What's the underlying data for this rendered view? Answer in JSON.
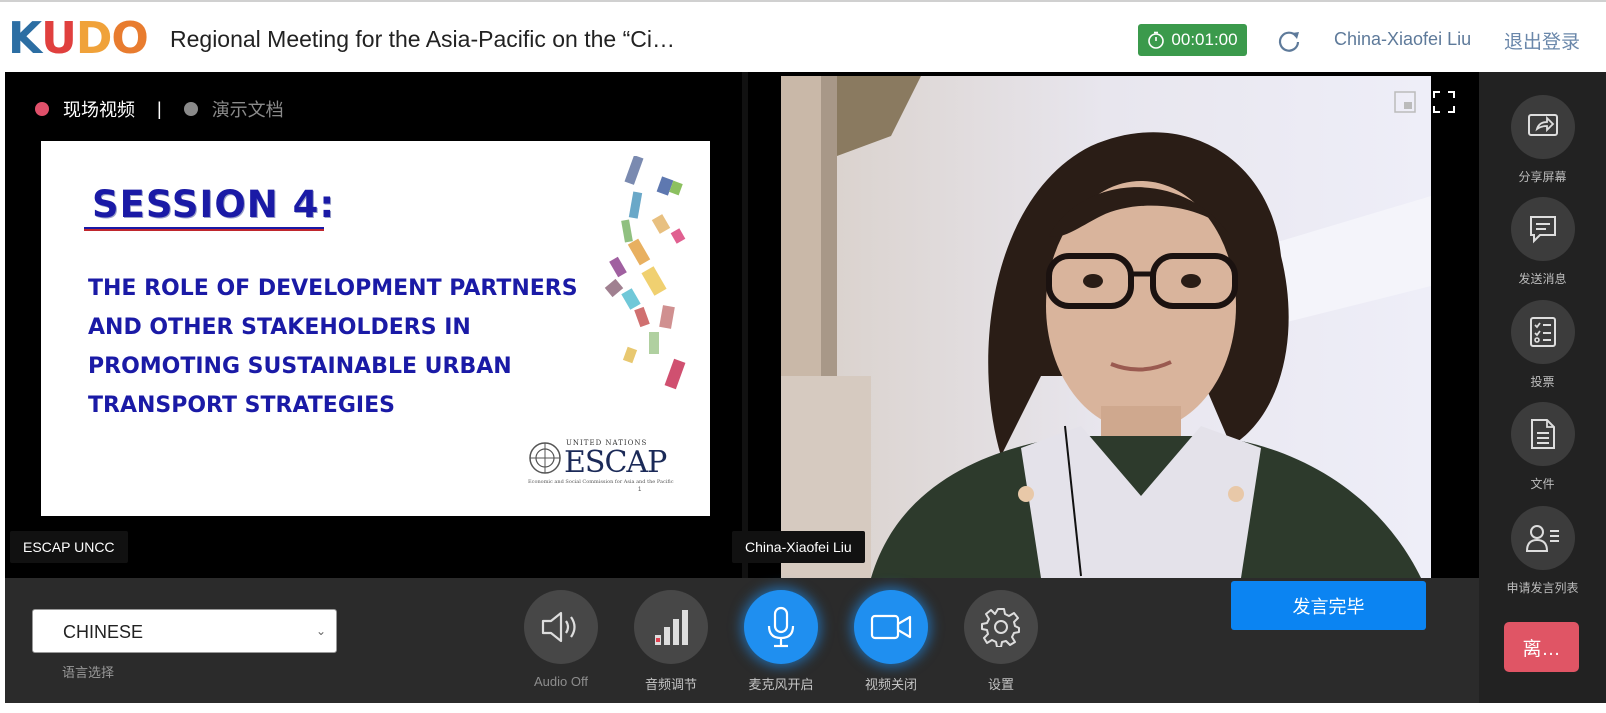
{
  "header": {
    "logo_letters": [
      "K",
      "U",
      "D",
      "O"
    ],
    "logo_colors": [
      "#2c6ea3",
      "#e0403e",
      "#f0a23a",
      "#e87c2f"
    ],
    "meeting_title": "Regional Meeting for the Asia-Pacific on the “Ci…",
    "timer": "00:01:00",
    "timer_color": "#3b9a4c",
    "user_name": "China-Xiaofei Liu",
    "logout_label": "退出登录"
  },
  "source_tabs": {
    "live_video": "现场视频",
    "separator": "|",
    "presentation_doc": "演示文档"
  },
  "slide": {
    "title": "SESSION 4:",
    "body_lines": [
      "THE ROLE OF DEVELOPMENT PARTNERS",
      "AND OTHER STAKEHOLDERS IN",
      "PROMOTING SUSTAINABLE URBAN",
      "TRANSPORT STRATEGIES"
    ],
    "logo_small": "UNITED NATIONS",
    "logo_big": "ESCAP",
    "logo_sub": "Economic and Social Commission for Asia and the Pacific",
    "page_number": "1"
  },
  "name_tags": {
    "left": "ESCAP UNCC",
    "right": "China-Xiaofei Liu"
  },
  "sidebar": {
    "items": [
      {
        "label": "分享屏幕",
        "icon": "share-screen-icon"
      },
      {
        "label": "发送消息",
        "icon": "message-icon"
      },
      {
        "label": "投票",
        "icon": "poll-icon"
      },
      {
        "label": "文件",
        "icon": "file-icon"
      },
      {
        "label": "申请发言列表",
        "icon": "speaker-list-icon"
      }
    ],
    "leave_label": "离…"
  },
  "bottombar": {
    "language_value": "CHINESE",
    "language_label": "语言选择",
    "controls": [
      {
        "label": "Audio Off",
        "icon": "speaker-icon"
      },
      {
        "label": "音频调节",
        "icon": "volume-bars-icon"
      },
      {
        "label": "麦克风开启",
        "icon": "microphone-icon"
      },
      {
        "label": "视频关闭",
        "icon": "video-camera-icon"
      },
      {
        "label": "设置",
        "icon": "gear-icon"
      }
    ],
    "finish_label": "发言完毕"
  }
}
